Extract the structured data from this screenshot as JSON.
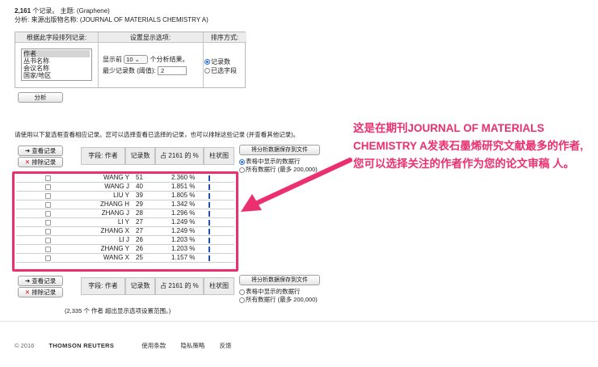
{
  "header": {
    "record_count": "2,161",
    "records_suffix": "个记录。 主题: (Graphene)",
    "analysis_line": "分析: 来源出版物名称: (JOURNAL OF MATERIALS CHEMISTRY A)"
  },
  "options": {
    "col1_header": "根据此字段排列记录:",
    "col2_header": "设置显示选项:",
    "col3_header": "排序方式:",
    "fields": [
      "作者",
      "丛书名称",
      "会议名称",
      "国家/地区"
    ],
    "show_prefix": "显示前",
    "show_value": "10 ⌄",
    "show_suffix": "个分析结果。",
    "min_label": "最少记录数 (阈值):",
    "min_value": "2",
    "sort_by_count": "记录数",
    "sort_by_field": "已选字段",
    "analyze_button": "分析"
  },
  "instructions": "请使用以下复选框查看相应记录。您可以选择查看已选择的记录，也可以排除这些记录 (并查看其他记录)。",
  "table": {
    "view_button": "查看记录",
    "exclude_button": "排除记录",
    "col_field": "字段: 作者",
    "col_count": "记录数",
    "col_pct": "占 2161 的 %",
    "col_bar": "柱状图",
    "save_button": "将分析数据保存到文件",
    "save_opt1": "表格中显示的数据行",
    "save_opt2": "所有数据行 (最多 200,000)",
    "rows": [
      {
        "name": "WANG Y",
        "count": "51",
        "pct": "2.360 %",
        "frac": 1.0
      },
      {
        "name": "WANG J",
        "count": "40",
        "pct": "1.851 %",
        "frac": 0.78
      },
      {
        "name": "LIU Y",
        "count": "39",
        "pct": "1.805 %",
        "frac": 0.76
      },
      {
        "name": "ZHANG H",
        "count": "29",
        "pct": "1.342 %",
        "frac": 0.57
      },
      {
        "name": "ZHANG J",
        "count": "28",
        "pct": "1.296 %",
        "frac": 0.55
      },
      {
        "name": "LI Y",
        "count": "27",
        "pct": "1.249 %",
        "frac": 0.53
      },
      {
        "name": "ZHANG X",
        "count": "27",
        "pct": "1.249 %",
        "frac": 0.53
      },
      {
        "name": "LI J",
        "count": "26",
        "pct": "1.203 %",
        "frac": 0.51
      },
      {
        "name": "ZHANG Y",
        "count": "26",
        "pct": "1.203 %",
        "frac": 0.51
      },
      {
        "name": "WANG X",
        "count": "25",
        "pct": "1.157 %",
        "frac": 0.49
      }
    ],
    "note": "(2,335 个 作者 超出显示选项设置范围。)"
  },
  "annotation": "这是在期刊JOURNAL OF MATERIALS CHEMISTRY A发表石墨烯研究文献最多的作者,您可以选择关注的作者作为您的论文审稿 人。",
  "footer": {
    "copyright": "© 2016",
    "brand": "THOMSON REUTERS",
    "terms": "使用条款",
    "privacy": "隐私策略",
    "feedback": "反馈"
  },
  "colors": {
    "accent": "#ec2f6e",
    "bar": "#1f4fb0"
  }
}
